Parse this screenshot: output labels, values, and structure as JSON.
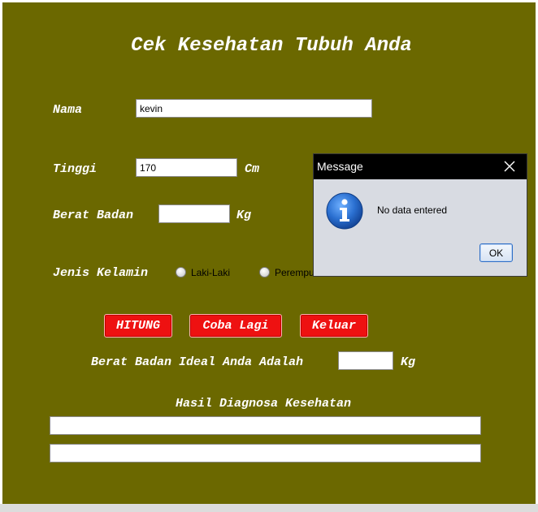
{
  "form": {
    "title": "Cek Kesehatan Tubuh Anda",
    "nama_label": "Nama",
    "nama_value": "kevin",
    "tinggi_label": "Tinggi",
    "tinggi_value": "170",
    "tinggi_unit": "Cm",
    "berat_label": "Berat Badan",
    "berat_value": "",
    "berat_unit": "Kg",
    "jenis_label": "Jenis Kelamin",
    "radio_laki": "Laki-Laki",
    "radio_perempuan": "Perempuan",
    "btn_hitung": "HITUNG",
    "btn_coba": "Coba Lagi",
    "btn_keluar": "Keluar",
    "ideal_label": "Berat Badan Ideal Anda Adalah",
    "ideal_value": "",
    "ideal_unit": "Kg",
    "hasil_label": "Hasil Diagnosa Kesehatan",
    "hasil_1": "",
    "hasil_2": ""
  },
  "dialog": {
    "title": "Message",
    "message": "No data entered",
    "ok_label": "OK",
    "icon": "info-icon",
    "close_icon": "close-icon"
  },
  "colors": {
    "background": "#6b6800",
    "button": "#ee1111",
    "dialog_titlebar": "#000000",
    "info_icon": "#1e64c8"
  }
}
